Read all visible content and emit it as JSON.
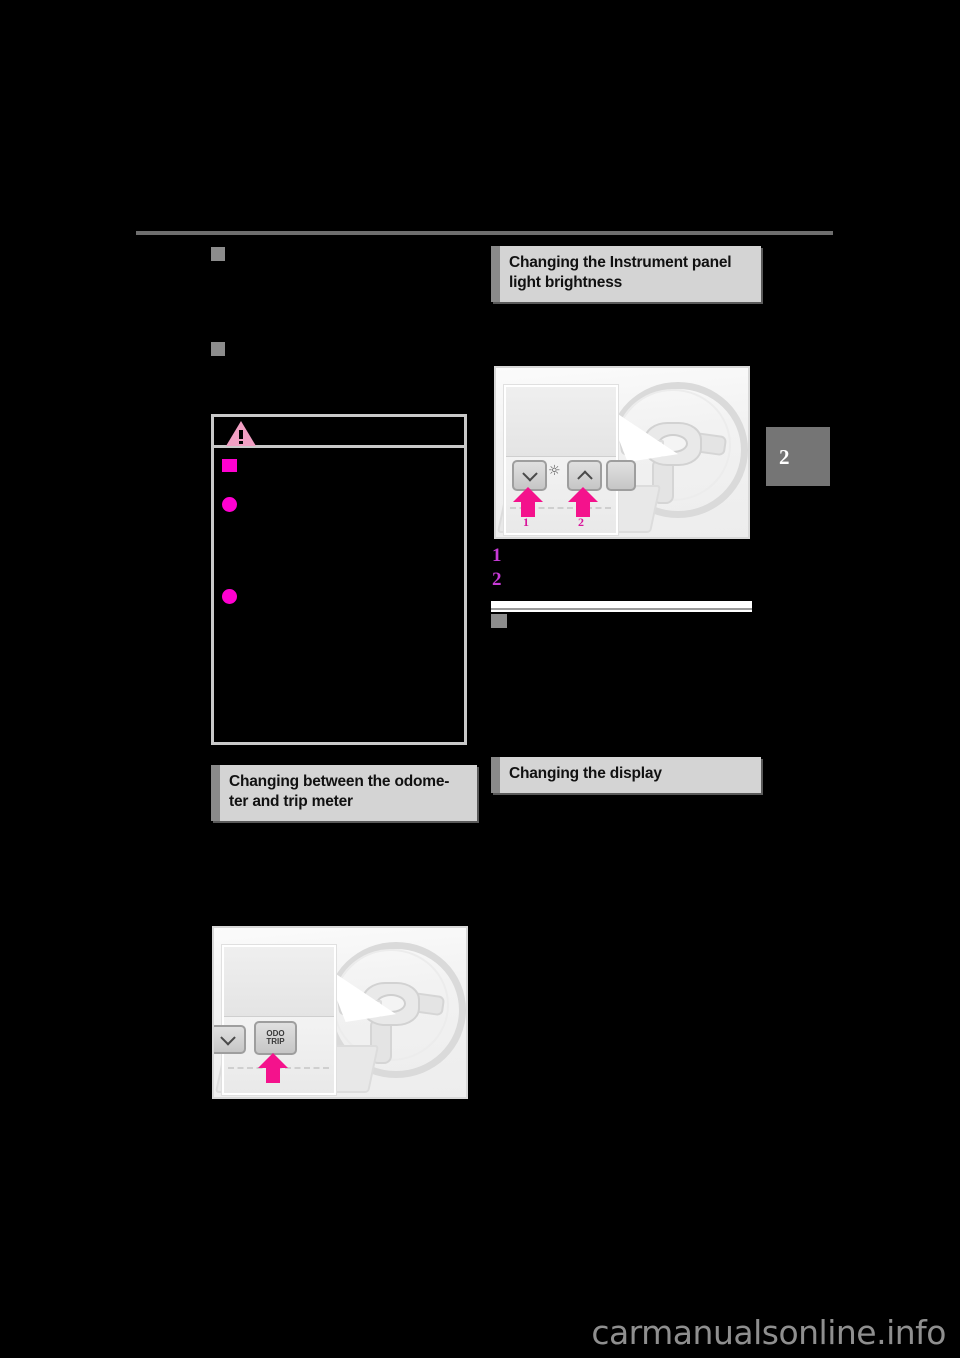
{
  "page": {
    "background_color": "#000000",
    "section_tab": "2",
    "watermark": "carmanualsonline.info"
  },
  "left_column": {
    "bullets": [
      {
        "name": "redacted-subheading-1"
      },
      {
        "name": "redacted-subheading-2"
      }
    ],
    "warning_box": {
      "icon": "warning-triangle-icon",
      "square_bullet": "caution-group-marker",
      "dot_bullets": [
        "caution-item-1",
        "caution-item-2"
      ]
    },
    "heading": "Changing between the odome-\nter and trip meter",
    "heading_line1": "Changing between the odome-",
    "heading_line2": "ter and trip meter",
    "figure": {
      "name": "odo-trip-button-illustration",
      "button_label_line1": "ODO",
      "button_label_line2": "TRIP",
      "arrow_color": "#f4128c"
    }
  },
  "right_column": {
    "heading_line1": "Changing the Instrument panel",
    "heading_line2": "light brightness",
    "figure": {
      "name": "instrument-panel-brightness-illustration",
      "callout_numbers": [
        "1",
        "2"
      ],
      "button_1_icon": "chevron-down-icon",
      "button_2_icon": "chevron-up-icon",
      "center_icon": "dimmer-lamp-icon",
      "arrow_color": "#f4128c"
    },
    "steps": [
      {
        "number": "1",
        "text": ""
      },
      {
        "number": "2",
        "text": ""
      }
    ],
    "divider_bullet": "redacted-subheading-3",
    "heading2": "Changing the display"
  }
}
